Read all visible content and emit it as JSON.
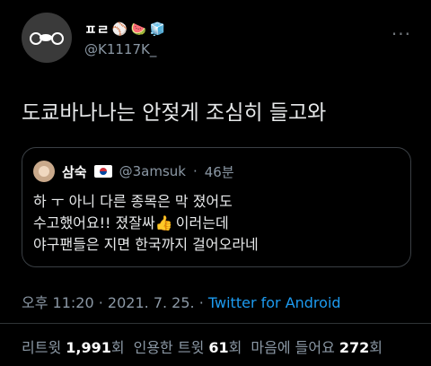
{
  "author": {
    "display_name": "ㅍㄹ",
    "emoji_baseball": "⚾",
    "emoji_watermelon": "🍉",
    "emoji_ice": "🧊",
    "username": "@K1117K_"
  },
  "more_label": "···",
  "tweet": {
    "text": "도쿄바나나는 안젖게 조심히 들고와"
  },
  "quote": {
    "name": "삼숙",
    "handle": "@3amsuk",
    "dot": "·",
    "time": "46분",
    "lines": [
      "하 ㅜ 아니 다른 종목은 막 졌어도",
      "수고했어요!! 졌잘싸",
      "이러는데",
      "야구팬들은 지면 한국까지 걸어오라네"
    ],
    "thumb_icon": "👍"
  },
  "meta": {
    "time": "오후 11:20",
    "sep1": "·",
    "date": "2021. 7. 25.",
    "sep2": "·",
    "source": "Twitter for Android"
  },
  "stats": {
    "retweets_label": "리트윗",
    "retweets": "1,991",
    "retweets_unit": "회",
    "quotes_label": "인용한 트윗",
    "quotes": "61",
    "quotes_unit": "회",
    "likes_label": "마음에 들어요",
    "likes": "272",
    "likes_unit": "회"
  }
}
